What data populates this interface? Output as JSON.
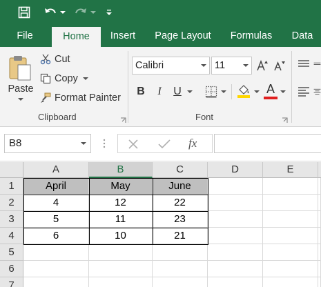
{
  "ribbon": {
    "tabs": [
      "File",
      "Home",
      "Insert",
      "Page Layout",
      "Formulas",
      "Data"
    ],
    "clipboard": {
      "paste_label": "Paste",
      "cut_label": "Cut",
      "copy_label": "Copy",
      "format_painter_label": "Format Painter",
      "group_label": "Clipboard"
    },
    "font": {
      "font_name": "Calibri",
      "font_size": "11",
      "bold_label": "B",
      "italic_label": "I",
      "underline_label": "U",
      "font_color_label": "A",
      "group_label": "Font"
    }
  },
  "formula_bar": {
    "name_box": "B8",
    "fx_label": "fx",
    "formula": ""
  },
  "sheet": {
    "columns": [
      "A",
      "B",
      "C",
      "D",
      "E"
    ],
    "rows": [
      "1",
      "2",
      "3",
      "4",
      "5",
      "6",
      "7"
    ],
    "selected_column": "B",
    "table": {
      "headers": [
        "April",
        "May",
        "June"
      ],
      "rows": [
        [
          "4",
          "12",
          "22"
        ],
        [
          "5",
          "11",
          "23"
        ],
        [
          "6",
          "10",
          "21"
        ]
      ]
    }
  },
  "colors": {
    "accent": "#217346",
    "font_color_swatch": "#e02020",
    "header_fill": "#bfbfbf"
  }
}
